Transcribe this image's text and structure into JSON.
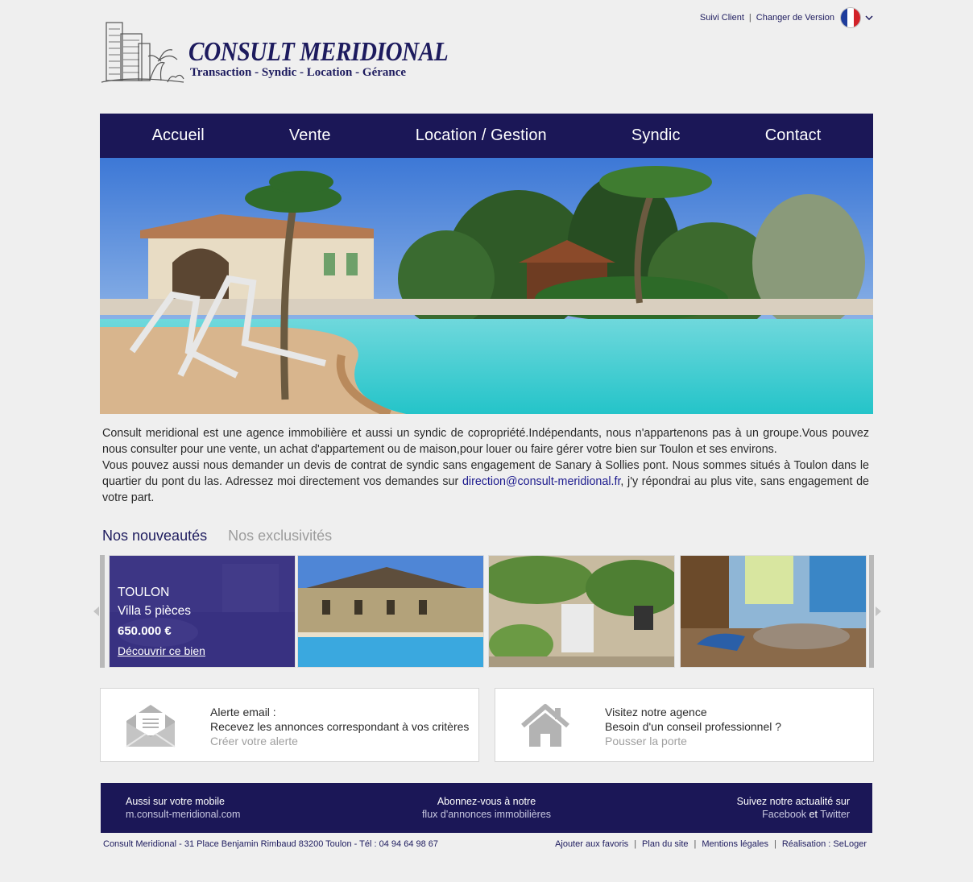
{
  "brand": {
    "name": "CONSULT MERIDIONAL",
    "tagline": "Transaction - Syndic - Location - Gérance"
  },
  "toplinks": {
    "client": "Suivi Client",
    "separator": "|",
    "version": "Changer de Version",
    "flag_icon": "france-flag-icon"
  },
  "nav": [
    {
      "label": "Accueil"
    },
    {
      "label": "Vente"
    },
    {
      "label": "Location / Gestion"
    },
    {
      "label": "Syndic"
    },
    {
      "label": "Contact"
    }
  ],
  "intro": {
    "p1": "Consult meridional est une agence immobilière et aussi un syndic de copropriété.Indépendants, nous n'appartenons pas à un groupe.Vous pouvez nous consulter pour une vente, un achat d'appartement ou de maison,pour louer ou faire gérer votre bien sur Toulon et ses environs.",
    "p2_start": "Vous pouvez aussi nous demander un devis de contrat de syndic sans engagement de Sanary à Sollies pont. Nous sommes situés à Toulon dans le quartier du pont du las. Adressez moi directement vos demandes sur ",
    "email": "direction@consult-meridional.fr",
    "p2_end": ", j'y répondrai au plus vite, sans engagement de votre part."
  },
  "tabs": {
    "active": "Nos nouveautés",
    "inactive": "Nos exclusivités"
  },
  "featured": {
    "city": "TOULON",
    "kind": "Villa 5 pièces",
    "price": "650.000 €",
    "cta": "Découvrir ce bien"
  },
  "boxes": {
    "alert": {
      "icon": "envelope-icon",
      "title": "Alerte email :",
      "text": "Recevez les annonces correspondant à vos critères",
      "cta": "Créer votre alerte"
    },
    "agency": {
      "icon": "house-icon",
      "title": "Visitez notre agence",
      "text": "Besoin d'un conseil professionnel ?",
      "cta": "Pousser la porte"
    }
  },
  "footer": {
    "mobile_title": "Aussi sur votre mobile",
    "mobile_url": "m.consult-meridional.com",
    "feed_title": "Abonnez-vous à notre",
    "feed_link": "flux d'annonces immobilières",
    "social_title": "Suivez notre actualité sur",
    "facebook": "Facebook",
    "and": "et",
    "twitter": "Twitter",
    "address": "Consult Meridional - 31 Place Benjamin Rimbaud 83200 Toulon - Tél : 04 94 64 98 67",
    "links": [
      "Ajouter aux favoris",
      "Plan du site",
      "Mentions légales",
      "Réalisation : SeLoger"
    ],
    "sep": "|"
  },
  "colors": {
    "navy": "#1b1757",
    "accent": "#1d1b5e",
    "overlay": "#2c2680"
  }
}
